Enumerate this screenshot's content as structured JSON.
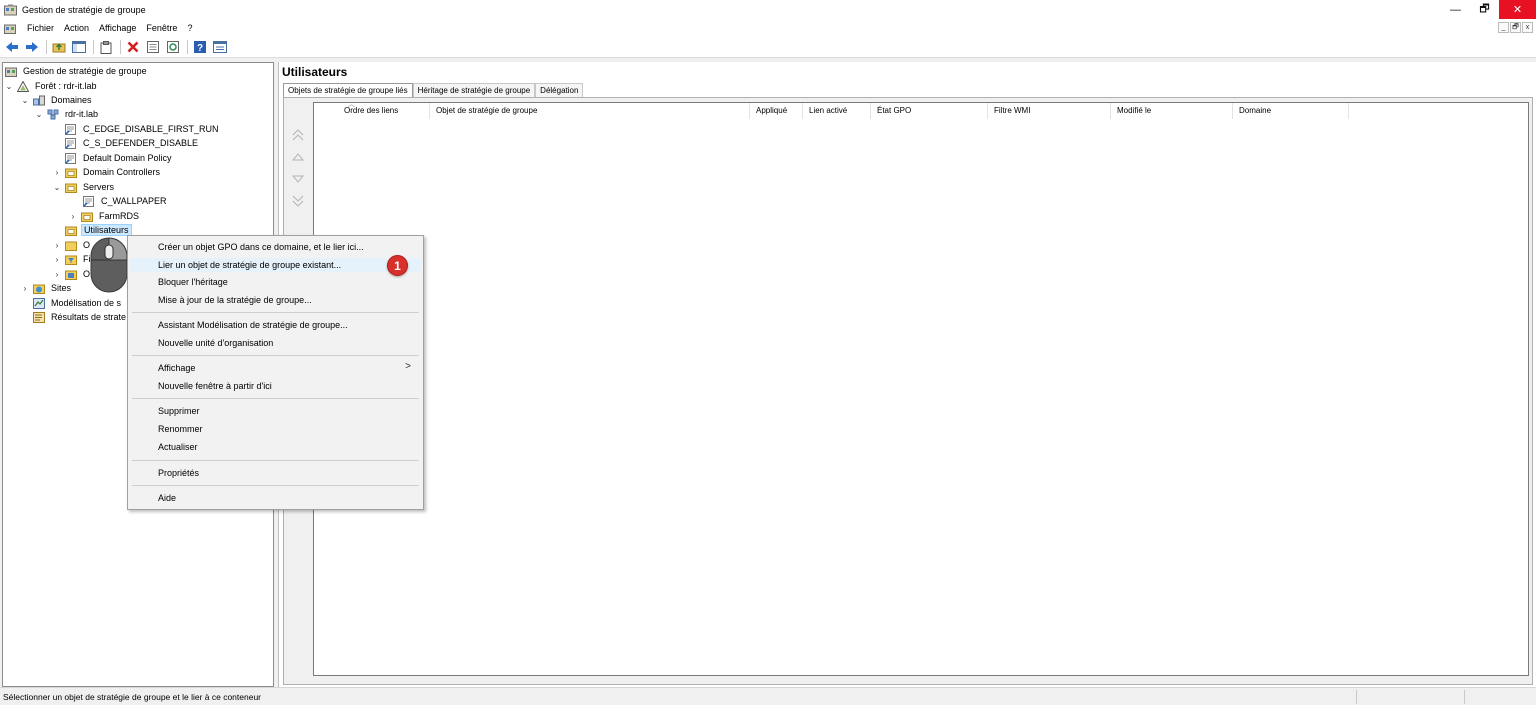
{
  "window": {
    "title": "Gestion de stratégie de groupe",
    "minimize": "—",
    "maximize": "🗗",
    "close": "✕"
  },
  "menubar": {
    "items": [
      "Fichier",
      "Action",
      "Affichage",
      "Fenêtre",
      "?"
    ],
    "mdi": [
      "_",
      "🗗",
      "x"
    ]
  },
  "tree": {
    "root": "Gestion de stratégie de groupe",
    "forest": "Forêt : rdr-it.lab",
    "domains": "Domaines",
    "domain": "rdr-it.lab",
    "gpo1": "C_EDGE_DISABLE_FIRST_RUN",
    "gpo2": "C_S_DEFENDER_DISABLE",
    "gpo3": "Default Domain Policy",
    "ou_dc": "Domain Controllers",
    "ou_servers": "Servers",
    "gpo_wallpaper": "C_WALLPAPER",
    "ou_farm": "FarmRDS",
    "ou_users": "Utilisateurs",
    "partial1": "O",
    "partial2": "Fi",
    "partial3": "O",
    "sites": "Sites",
    "modeling": "Modélisation de s",
    "results": "Résultats de strate"
  },
  "panel": {
    "title": "Utilisateurs",
    "tabs": [
      "Objets de stratégie de groupe liés",
      "Héritage de stratégie de groupe",
      "Délégation"
    ],
    "columns": [
      "Ordre des liens",
      "Objet de stratégie de groupe",
      "Appliqué",
      "Lien activé",
      "État GPO",
      "Filtre WMI",
      "Modifié le",
      "Domaine"
    ]
  },
  "context_menu": {
    "items": [
      "Créer un objet GPO dans ce domaine, et le lier ici...",
      "Lier un objet de stratégie de groupe existant...",
      "Bloquer l'héritage",
      "Mise à jour de la stratégie de groupe...",
      "Assistant Modélisation de stratégie de groupe...",
      "Nouvelle unité d'organisation",
      "Affichage",
      "Nouvelle fenêtre à partir d'ici",
      "Supprimer",
      "Renommer",
      "Actualiser",
      "Propriétés",
      "Aide"
    ],
    "highlighted_index": 1,
    "submenu_arrow": ">"
  },
  "badge": "1",
  "status": {
    "text": "Sélectionner un objet de stratégie de groupe et le lier à ce conteneur"
  },
  "colors": {
    "close_button": "#e81123",
    "selection": "#cce8ff",
    "badge": "#d9302c",
    "menu_highlight": "#e5f1fb"
  }
}
